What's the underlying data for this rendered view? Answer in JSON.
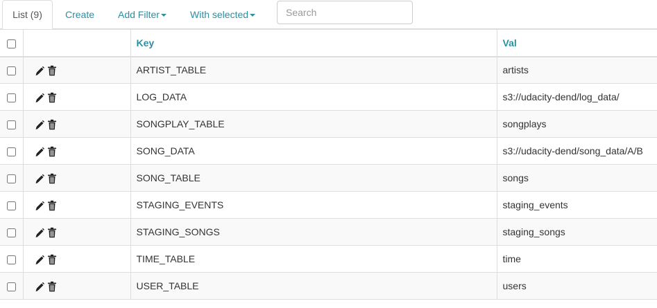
{
  "toolbar": {
    "list_tab": "List (9)",
    "create": "Create",
    "add_filter": "Add Filter",
    "with_selected": "With selected",
    "search_placeholder": "Search"
  },
  "table": {
    "headers": {
      "key": "Key",
      "val": "Val"
    },
    "rows": [
      {
        "key": "ARTIST_TABLE",
        "val": "artists"
      },
      {
        "key": "LOG_DATA",
        "val": "s3://udacity-dend/log_data/"
      },
      {
        "key": "SONGPLAY_TABLE",
        "val": "songplays"
      },
      {
        "key": "SONG_DATA",
        "val": "s3://udacity-dend/song_data/A/B"
      },
      {
        "key": "SONG_TABLE",
        "val": "songs"
      },
      {
        "key": "STAGING_EVENTS",
        "val": "staging_events"
      },
      {
        "key": "STAGING_SONGS",
        "val": "staging_songs"
      },
      {
        "key": "TIME_TABLE",
        "val": "time"
      },
      {
        "key": "USER_TABLE",
        "val": "users"
      }
    ]
  },
  "icons": {
    "edit": "pencil-icon",
    "delete": "trash-icon"
  },
  "colors": {
    "link": "#2a8fa3",
    "text": "#333333",
    "border": "#dddddd",
    "stripe": "#f9f9f9"
  }
}
